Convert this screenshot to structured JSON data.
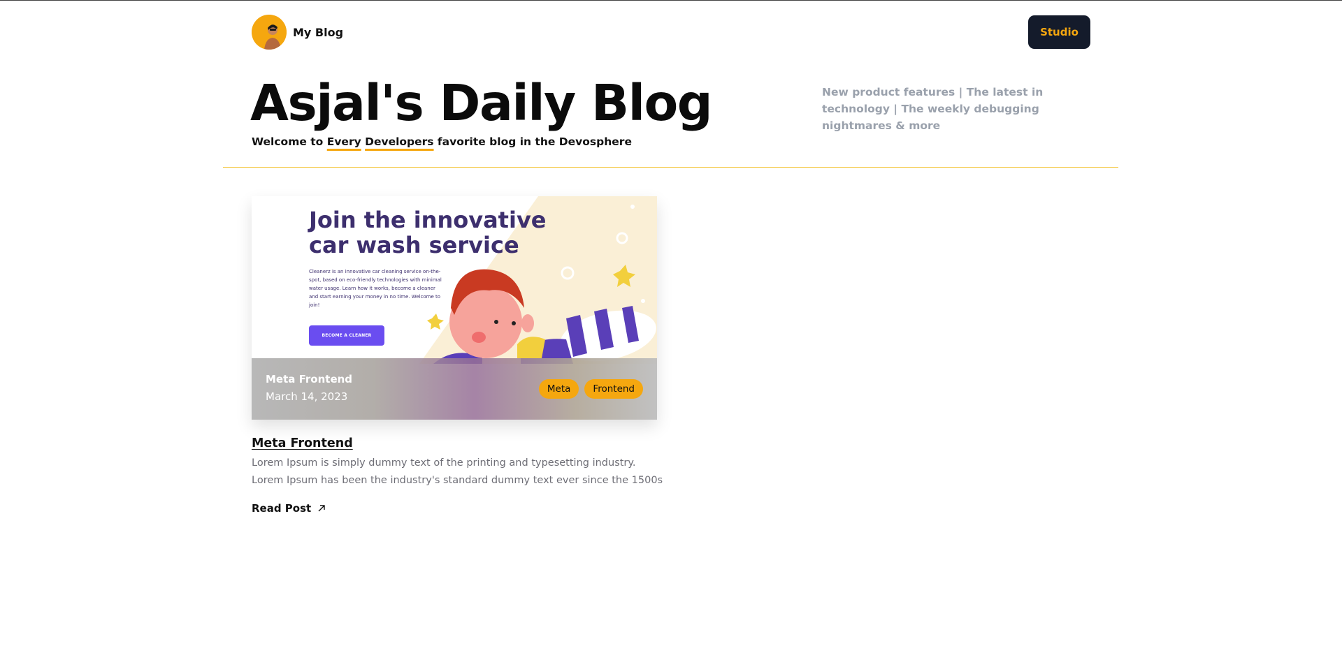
{
  "header": {
    "brand_name": "My Blog",
    "studio_label": "Studio"
  },
  "hero": {
    "title": "Asjal's Daily Blog",
    "subtitle_prefix": "Welcome to ",
    "subtitle_word1": "Every",
    "subtitle_word2": "Developers",
    "subtitle_suffix": " favorite blog in the Devosphere",
    "tagline": "New product features | The latest in technology | The weekly debugging nightmares & more"
  },
  "post": {
    "image_heading_line1": "Join the innovative",
    "image_heading_line2": "car wash service",
    "image_paragraph": "Cleanerz is an innovative car cleaning service on-the-spot, based on eco-friendly technologies with minimal water usage. Learn how it works, become a cleaner and start earning your money in no time. Welcome to join!",
    "image_button": "BECOME A CLEANER",
    "overlay_title": "Meta Frontend",
    "date": "March 14, 2023",
    "tags": [
      "Meta",
      "Frontend"
    ],
    "title": "Meta Frontend",
    "excerpt": "Lorem Ipsum is simply dummy text of the printing and typesetting industry. Lorem Ipsum has been the industry's standard dummy text ever since the 1500s",
    "read_label": "Read Post"
  },
  "colors": {
    "accent": "#f5a70f",
    "button_dark": "#141b2b",
    "tagline": "#9aa1ac",
    "illustration_purple": "#3d2f6e",
    "illustration_button": "#6a4df0"
  }
}
